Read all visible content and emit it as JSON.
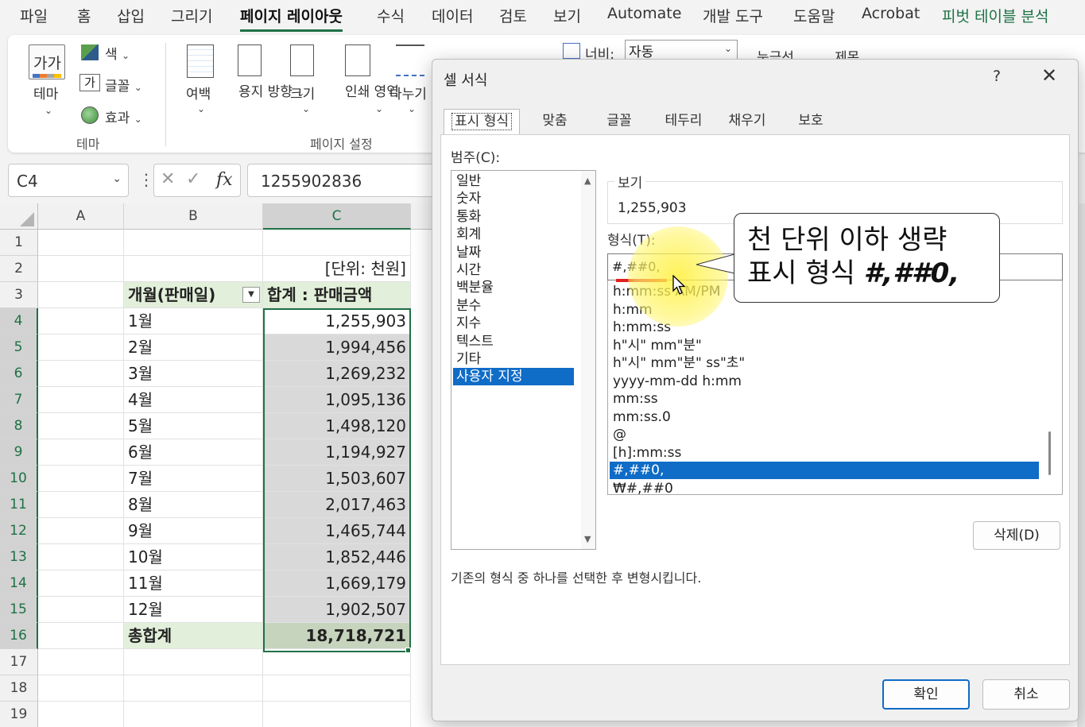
{
  "menu": [
    "파일",
    "홈",
    "삽입",
    "그리기",
    "페이지 레이아웃",
    "수식",
    "데이터",
    "검토",
    "보기",
    "Automate",
    "개발 도구",
    "도움말",
    "Acrobat",
    "피벗 테이블 분석"
  ],
  "ribbon": {
    "theme_label": "테마",
    "theme_icon_text": "가가",
    "colors": "색",
    "fonts": "글꼴",
    "fonts_icon": "가",
    "effects": "효과",
    "theme_group": "테마",
    "margins": "여백",
    "orientation": "용지 방향",
    "size": "크기",
    "print_area": "인쇄 영역",
    "breaks": "나누기",
    "page_setup_group": "페이지 설정",
    "width_label": "너비:",
    "width_value": "자동",
    "gridlines": "눈금선",
    "headings": "제목"
  },
  "formula_bar": {
    "name_box": "C4",
    "formula_value": "1255902836",
    "fx": "fx"
  },
  "sheet": {
    "columns": [
      "A",
      "B",
      "C"
    ],
    "rows": [
      "1",
      "2",
      "3",
      "4",
      "5",
      "6",
      "7",
      "8",
      "9",
      "10",
      "11",
      "12",
      "13",
      "14",
      "15",
      "16",
      "17",
      "18",
      "19"
    ],
    "unit_note": "[단위: 천원]",
    "header_b": "개월(판매일)",
    "header_c": "합계 : 판매금액",
    "data": [
      {
        "month": "1월",
        "value": "1,255,903"
      },
      {
        "month": "2월",
        "value": "1,994,456"
      },
      {
        "month": "3월",
        "value": "1,269,232"
      },
      {
        "month": "4월",
        "value": "1,095,136"
      },
      {
        "month": "5월",
        "value": "1,498,120"
      },
      {
        "month": "6월",
        "value": "1,194,927"
      },
      {
        "month": "7월",
        "value": "1,503,607"
      },
      {
        "month": "8월",
        "value": "2,017,463"
      },
      {
        "month": "9월",
        "value": "1,465,744"
      },
      {
        "month": "10월",
        "value": "1,852,446"
      },
      {
        "month": "11월",
        "value": "1,669,179"
      },
      {
        "month": "12월",
        "value": "1,902,507"
      }
    ],
    "total_label": "총합계",
    "total_value": "18,718,721"
  },
  "dialog": {
    "title": "셀 서식",
    "help": "?",
    "close": "✕",
    "tabs": [
      "표시 형식",
      "맞춤",
      "글꼴",
      "테두리",
      "채우기",
      "보호"
    ],
    "category_label": "범주(C):",
    "categories": [
      "일반",
      "숫자",
      "통화",
      "회계",
      "날짜",
      "시간",
      "백분율",
      "분수",
      "지수",
      "텍스트",
      "기타",
      "사용자 지정"
    ],
    "sample_label": "보기",
    "sample_value": "1,255,903",
    "type_label": "형식(T):",
    "type_value": "#,##0,",
    "formats": [
      "h:mm:ss AM/PM",
      "h:mm",
      "h:mm:ss",
      "h\"시\" mm\"분\"",
      "h\"시\" mm\"분\" ss\"초\"",
      "yyyy-mm-dd h:mm",
      "mm:ss",
      "mm:ss.0",
      "@",
      "[h]:mm:ss",
      "#,##0,",
      "₩#,##0"
    ],
    "delete_button": "삭제(D)",
    "description": "기존의 형식 중 하나를 선택한 후 변형시킵니다.",
    "ok_button": "확인",
    "cancel_button": "취소"
  },
  "callout": {
    "line1": "천 단위 이하 생략",
    "line2_prefix": "표시 형식",
    "line2_code": "#,##0,"
  },
  "colors": {
    "accent_green": "#1e7145",
    "selection_blue": "#0f6cc7",
    "pivot_header": "#e2efda",
    "highlight_yellow": "#fff03c",
    "underline_red": "#e0201d"
  }
}
